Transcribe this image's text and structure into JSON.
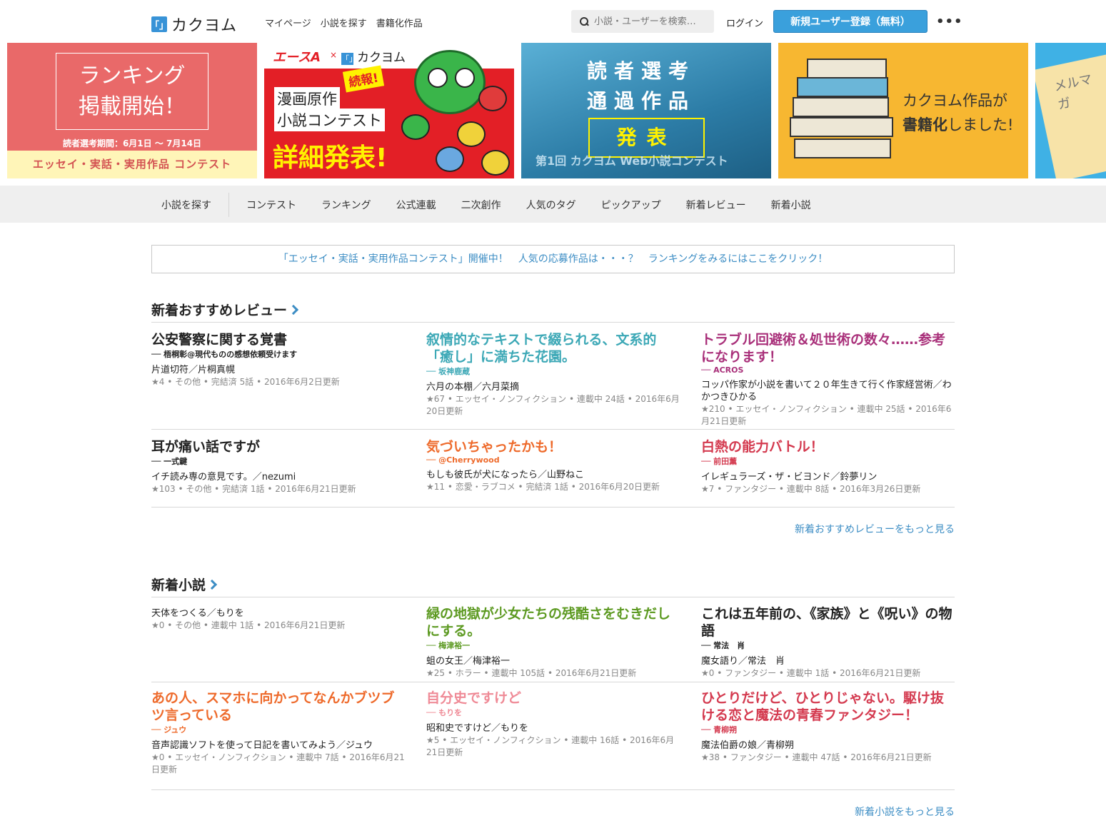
{
  "header": {
    "logo_mark": "「」",
    "logo_text": "カクヨム",
    "nav": [
      "マイページ",
      "小説を探す",
      "書籍化作品"
    ],
    "search_placeholder": "小説・ユーザーを検索…",
    "login": "ログイン",
    "signup": "新規ユーザー登録（無料）",
    "more": "•••"
  },
  "banners": {
    "b1": {
      "line1": "ランキング",
      "line2": "掲載開始！",
      "period": "読者選考期間：6月1日 〜 7月14日",
      "bottom": "エッセイ・実話・実用作品 コンテスト"
    },
    "b2": {
      "magazine": "エースA",
      "x": "×",
      "kakuyomu_mark": "「」",
      "kakuyomu": "カクヨム",
      "badge": "続報!",
      "line1": "漫画原作",
      "line2": "小説コンテスト",
      "line3": "詳細発表!"
    },
    "b3": {
      "line1": "読者選考",
      "line2": "通過作品",
      "badge": "発表",
      "contest": "第1回 カクヨム Web小説コンテスト"
    },
    "b4": {
      "line1": "カクヨム作品が",
      "line2a": "書籍化",
      "line2b": "しました!"
    },
    "b5": {
      "text": "メルマガ"
    }
  },
  "subnav": [
    "小説を探す",
    "コンテスト",
    "ランキング",
    "公式連載",
    "二次創作",
    "人気のタグ",
    "ピックアップ",
    "新着レビュー",
    "新着小説"
  ],
  "notice": "「エッセイ・実話・実用作品コンテスト」開催中！　人気の応募作品は・・・？　ランキングをみるにはここをクリック！",
  "reviews": {
    "title": "新着おすすめレビュー",
    "more": "新着おすすめレビューをもっと見る",
    "items": [
      {
        "review": "公安警察に関する覚書",
        "by": "── 梧桐彰@現代ものの感想依頼受けます",
        "color": "#222222",
        "work": "片道切符／片桐真幌",
        "meta": "★4 • その他 • 完結済 5話 • 2016年6月2日更新"
      },
      {
        "review": "叙情的なテキストで綴られる、文系的「癒し」に満ちた花園。",
        "by": "── 坂神鹿蔵",
        "color": "#3ca8b6",
        "work": "六月の本棚／六月菜摘",
        "meta": "★67 • エッセイ・ノンフィクション • 連載中 24話 • 2016年6月20日更新"
      },
      {
        "review": "トラブル回避術＆処世術の数々……参考になります！",
        "by": "── ACROS",
        "color": "#a9307a",
        "work": "コッパ作家が小説を書いて２０年生きて行く作家経営術／わかつきひかる",
        "meta": "★210 • エッセイ・ノンフィクション • 連載中 25話 • 2016年6月21日更新"
      },
      {
        "review": "耳が痛い話ですが",
        "by": "── 一式鍵",
        "color": "#222222",
        "work": "イチ読み専の意見です。／nezumi",
        "meta": "★103 • その他 • 完結済 1話 • 2016年6月21日更新"
      },
      {
        "review": "気づいちゃったかも！",
        "by": "── @Cherrywood",
        "color": "#ee6a2b",
        "work": "もしも彼氏が犬になったら／山野ねこ",
        "meta": "★11 • 恋愛・ラブコメ • 完結済 1話 • 2016年6月20日更新"
      },
      {
        "review": "白熱の能力バトル！",
        "by": "── 前田薫",
        "color": "#d43a4f",
        "work": "イレギュラーズ・ザ・ビヨンド／鈴夢リン",
        "meta": "★7 • ファンタジー • 連載中 8話 • 2016年3月26日更新"
      }
    ]
  },
  "novels": {
    "title": "新着小説",
    "more": "新着小説をもっと見る",
    "items": [
      {
        "review": "",
        "by": "",
        "color": "#222222",
        "work": "天体をつくる／もりを",
        "meta": "★0 • その他 • 連載中 1話 • 2016年6月21日更新"
      },
      {
        "review": "緑の地獄が少女たちの残酷さをむきだしにする。",
        "by": "── 梅津裕一",
        "color": "#5d9a22",
        "work": "蛆の女王／梅津裕一",
        "meta": "★25 • ホラー • 連載中 105話 • 2016年6月21日更新"
      },
      {
        "review": "これは五年前の、《家族》と《呪い》の物語",
        "by": "── 常法　肖",
        "color": "#222222",
        "work": "魔女語り／常法　肖",
        "meta": "★0 • ファンタジー • 連載中 1話 • 2016年6月21日更新"
      },
      {
        "review": "あの人、スマホに向かってなんかブツブツ言っている",
        "by": "── ジュウ",
        "color": "#ee6a2b",
        "work": "音声認識ソフトを使って日記を書いてみよう／ジュウ",
        "meta": "★0 • エッセイ・ノンフィクション • 連載中 7話 • 2016年6月21日更新"
      },
      {
        "review": "自分史ですけど",
        "by": "── もりを",
        "color": "#ef8a96",
        "work": "昭和史ですけど／もりを",
        "meta": "★5 • エッセイ・ノンフィクション • 連載中 16話 • 2016年6月21日更新"
      },
      {
        "review": "ひとりだけど、ひとりじゃない。駆け抜ける恋と魔法の青春ファンタジー！",
        "by": "── 青柳朔",
        "color": "#d43a4f",
        "work": "魔法伯爵の娘／青柳朔",
        "meta": "★38 • ファンタジー • 連載中 47話 • 2016年6月21日更新"
      }
    ]
  }
}
